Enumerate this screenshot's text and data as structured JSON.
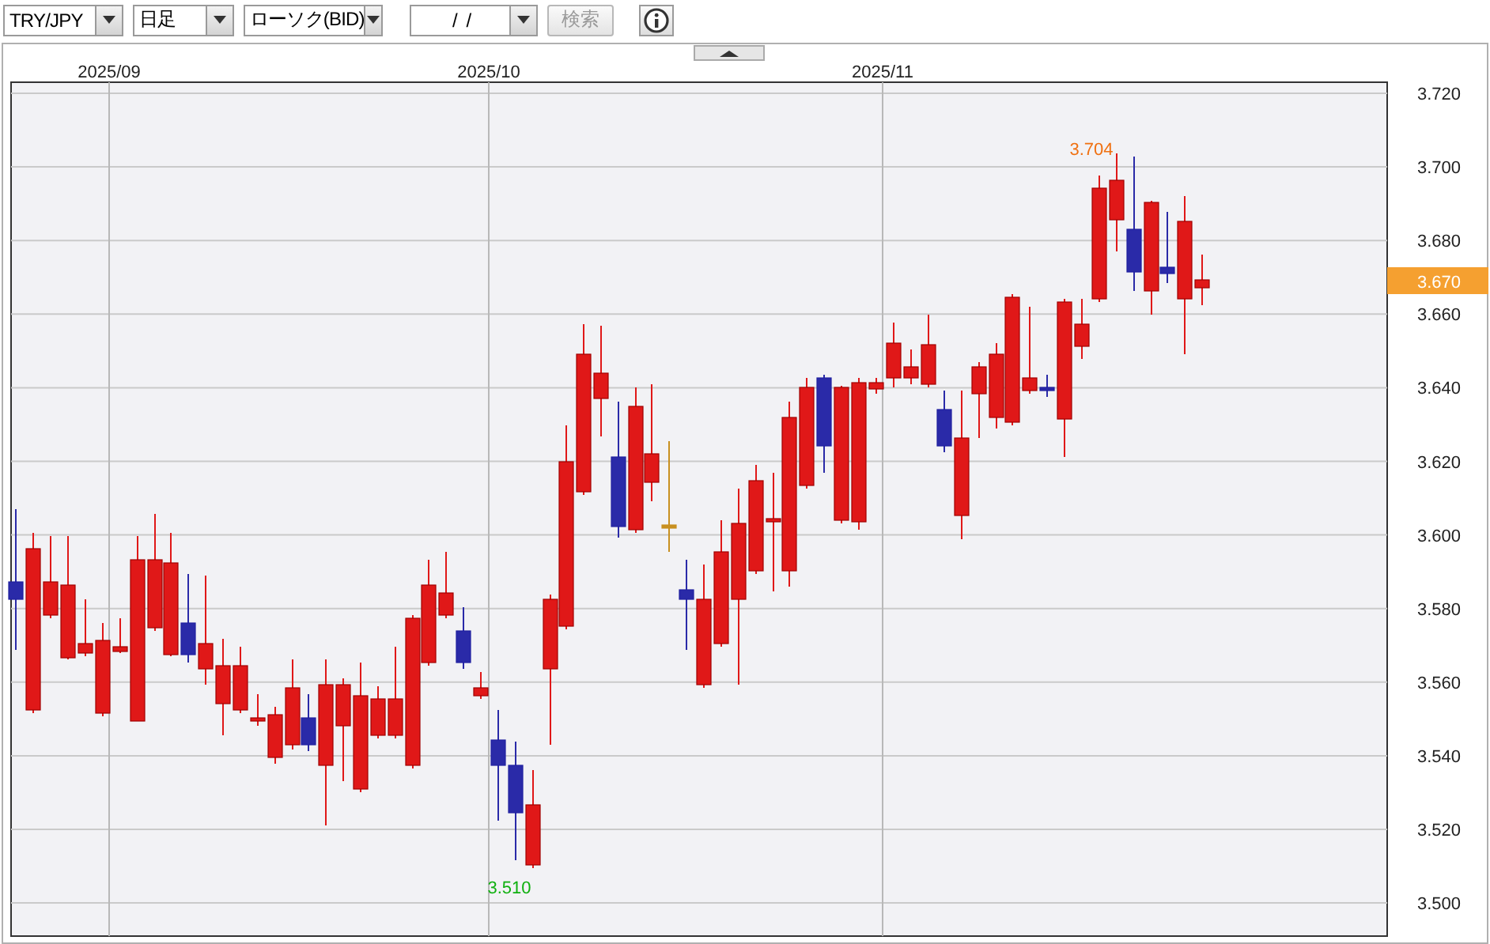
{
  "toolbar": {
    "pair": "TRY/JPY",
    "period": "日足",
    "chart_type": "ローソク(BID)",
    "date": "/  /",
    "search_button": {
      "label": "検索",
      "disabled": true
    }
  },
  "chart": {
    "x_labels": [
      "2025/09",
      "2025/10",
      "2025/11"
    ],
    "y_labels": [
      "3.720",
      "3.700",
      "3.680",
      "3.660",
      "3.640",
      "3.620",
      "3.600",
      "3.580",
      "3.560",
      "3.540",
      "3.520",
      "3.500"
    ],
    "current_price": "3.670",
    "high_label": "3.704",
    "low_label": "3.510"
  }
}
